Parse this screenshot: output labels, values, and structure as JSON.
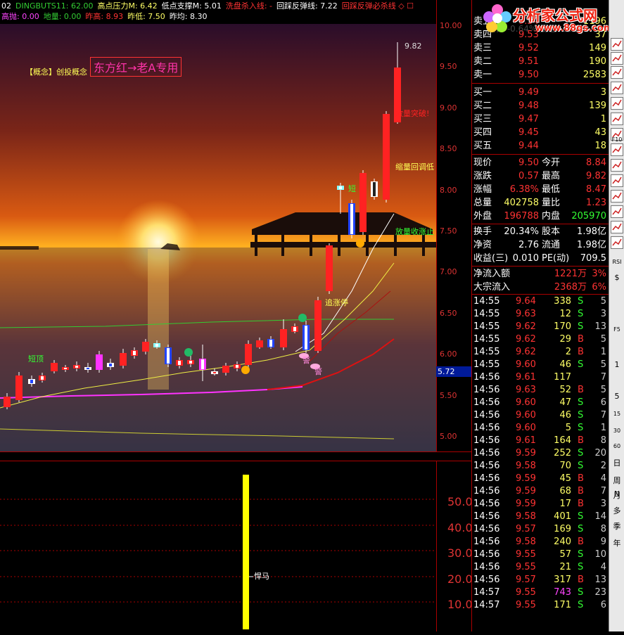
{
  "topbar": {
    "items1": [
      {
        "text": "02",
        "color": "#ffffff"
      },
      {
        "text": "DINGBUTS11: 62.00",
        "color": "#33cc33"
      },
      {
        "text": "高点压力M: 6.42",
        "color": "#ffff66"
      },
      {
        "text": "低点支撑M: 5.01",
        "color": "#ffffff"
      },
      {
        "text": "洗盘杀入线: -",
        "color": "#ff3333"
      },
      {
        "text": "回踩反弹线: 7.22",
        "color": "#ffffff"
      },
      {
        "text": "回踩反弹必杀线 ◇ ☐",
        "color": "#ff3333"
      }
    ],
    "items2": [
      {
        "text": "高抛: 0.00",
        "color": "#ff44ff"
      },
      {
        "text": "地量: 0.00",
        "color": "#33cc33"
      },
      {
        "text": "昨高: 8.93",
        "color": "#ff3333"
      },
      {
        "text": "昨低: 7.50",
        "color": "#ffff66"
      },
      {
        "text": "昨均: 8.30",
        "color": "#ffffff"
      }
    ]
  },
  "chart_annotations": {
    "concept": "【概念】创投概念",
    "banner": "东方红→老A专用",
    "short_top_1": "短顶",
    "short_top_2": "短",
    "chase_limit": "追涨停",
    "shrink_pullback": "缩量回调低",
    "vol_shrink_stop": "放量收涨止",
    "vol_break": "放量突破!",
    "warn_1": "警",
    "warn_2": "警",
    "high_label": "9.82",
    "dark_horse": "悍马"
  },
  "price_axis": [
    "10.00",
    "9.50",
    "9.00",
    "8.50",
    "8.00",
    "7.50",
    "7.00",
    "6.50",
    "6.00",
    "5.50",
    "5.00"
  ],
  "current_price_tag": "5.72",
  "sub_axis": [
    "50.00",
    "40.00",
    "30.00",
    "20.00",
    "10.00"
  ],
  "logo": {
    "text": "分析家公式网",
    "url": "www.88gs.com",
    "faded": "委比 -0.64% 委差 -3951"
  },
  "quote": {
    "sell": [
      {
        "label": "卖五",
        "price": "9.54",
        "vol": "1196"
      },
      {
        "label": "卖四",
        "price": "9.53",
        "vol": "37"
      },
      {
        "label": "卖三",
        "price": "9.52",
        "vol": "149"
      },
      {
        "label": "卖二",
        "price": "9.51",
        "vol": "190"
      },
      {
        "label": "卖一",
        "price": "9.50",
        "vol": "2583"
      }
    ],
    "buy": [
      {
        "label": "买一",
        "price": "9.49",
        "vol": "3"
      },
      {
        "label": "买二",
        "price": "9.48",
        "vol": "139"
      },
      {
        "label": "买三",
        "price": "9.47",
        "vol": "1"
      },
      {
        "label": "买四",
        "price": "9.45",
        "vol": "43"
      },
      {
        "label": "买五",
        "price": "9.44",
        "vol": "18"
      }
    ],
    "stats": [
      {
        "l1": "现价",
        "v1": "9.50",
        "c1": "#ff3333",
        "l2": "今开",
        "v2": "8.84",
        "c2": "#ff3333"
      },
      {
        "l1": "涨跌",
        "v1": "0.57",
        "c1": "#ff3333",
        "l2": "最高",
        "v2": "9.82",
        "c2": "#ff3333"
      },
      {
        "l1": "涨幅",
        "v1": "6.38%",
        "c1": "#ff3333",
        "l2": "最低",
        "v2": "8.47",
        "c2": "#ff3333"
      },
      {
        "l1": "总量",
        "v1": "402758",
        "c1": "#ffff66",
        "l2": "量比",
        "v2": "1.23",
        "c2": "#ff3333"
      },
      {
        "l1": "外盘",
        "v1": "196788",
        "c1": "#ff3333",
        "l2": "内盘",
        "v2": "205970",
        "c2": "#33ff33"
      }
    ],
    "fund": [
      {
        "l1": "换手",
        "v1": "20.34%",
        "c1": "#ffffff",
        "l2": "股本",
        "v2": "1.98亿",
        "c2": "#ffffff"
      },
      {
        "l1": "净资",
        "v1": "2.76",
        "c1": "#ffffff",
        "l2": "流通",
        "v2": "1.98亿",
        "c2": "#ffffff"
      },
      {
        "l1": "收益(三)",
        "v1": "0.010",
        "c1": "#ffffff",
        "l2": "PE(动)",
        "v2": "709.5",
        "c2": "#ffffff"
      }
    ],
    "flow": [
      {
        "label": "净流入额",
        "value": "1221万",
        "pct": "3%"
      },
      {
        "label": "大宗流入",
        "value": "2368万",
        "pct": "6%"
      }
    ]
  },
  "ticks": [
    {
      "time": "14:55",
      "price": "9.64",
      "vol": "338",
      "side": "S",
      "n": "5"
    },
    {
      "time": "14:55",
      "price": "9.63",
      "vol": "12",
      "side": "S",
      "n": "3"
    },
    {
      "time": "14:55",
      "price": "9.62",
      "vol": "170",
      "side": "S",
      "n": "13"
    },
    {
      "time": "14:55",
      "price": "9.62",
      "vol": "29",
      "side": "B",
      "n": "5"
    },
    {
      "time": "14:55",
      "price": "9.62",
      "vol": "2",
      "side": "B",
      "n": "1"
    },
    {
      "time": "14:55",
      "price": "9.60",
      "vol": "46",
      "side": "S",
      "n": "5"
    },
    {
      "time": "14:56",
      "price": "9.61",
      "vol": "117",
      "side": "",
      "n": "7"
    },
    {
      "time": "14:56",
      "price": "9.63",
      "vol": "52",
      "side": "B",
      "n": "5"
    },
    {
      "time": "14:56",
      "price": "9.60",
      "vol": "47",
      "side": "S",
      "n": "6"
    },
    {
      "time": "14:56",
      "price": "9.60",
      "vol": "46",
      "side": "S",
      "n": "7"
    },
    {
      "time": "14:56",
      "price": "9.60",
      "vol": "5",
      "side": "S",
      "n": "1"
    },
    {
      "time": "14:56",
      "price": "9.61",
      "vol": "164",
      "side": "B",
      "n": "8"
    },
    {
      "time": "14:56",
      "price": "9.59",
      "vol": "252",
      "side": "S",
      "n": "20"
    },
    {
      "time": "14:56",
      "price": "9.58",
      "vol": "70",
      "side": "S",
      "n": "2"
    },
    {
      "time": "14:56",
      "price": "9.59",
      "vol": "45",
      "side": "B",
      "n": "4"
    },
    {
      "time": "14:56",
      "price": "9.59",
      "vol": "68",
      "side": "B",
      "n": "7"
    },
    {
      "time": "14:56",
      "price": "9.59",
      "vol": "17",
      "side": "B",
      "n": "3"
    },
    {
      "time": "14:56",
      "price": "9.58",
      "vol": "401",
      "side": "S",
      "n": "14"
    },
    {
      "time": "14:56",
      "price": "9.57",
      "vol": "169",
      "side": "S",
      "n": "8"
    },
    {
      "time": "14:56",
      "price": "9.58",
      "vol": "240",
      "side": "B",
      "n": "9"
    },
    {
      "time": "14:56",
      "price": "9.55",
      "vol": "57",
      "side": "S",
      "n": "10"
    },
    {
      "time": "14:56",
      "price": "9.55",
      "vol": "21",
      "side": "S",
      "n": "4"
    },
    {
      "time": "14:56",
      "price": "9.57",
      "vol": "317",
      "side": "B",
      "n": "13"
    },
    {
      "time": "14:57",
      "price": "9.55",
      "vol": "743",
      "side": "S",
      "n": "23"
    },
    {
      "time": "14:57",
      "price": "9.55",
      "vol": "171",
      "side": "S",
      "n": "6"
    }
  ],
  "toolbar": [
    "F10",
    "RSI",
    "$",
    "日",
    "周",
    "月",
    "N",
    "多",
    "季",
    "年",
    "5",
    "15",
    "30",
    "60",
    "1",
    "F5"
  ],
  "colors": {
    "up": "#ff3333",
    "down": "#33ff33",
    "grid": "#aa0000",
    "accent": "#ffff00"
  }
}
